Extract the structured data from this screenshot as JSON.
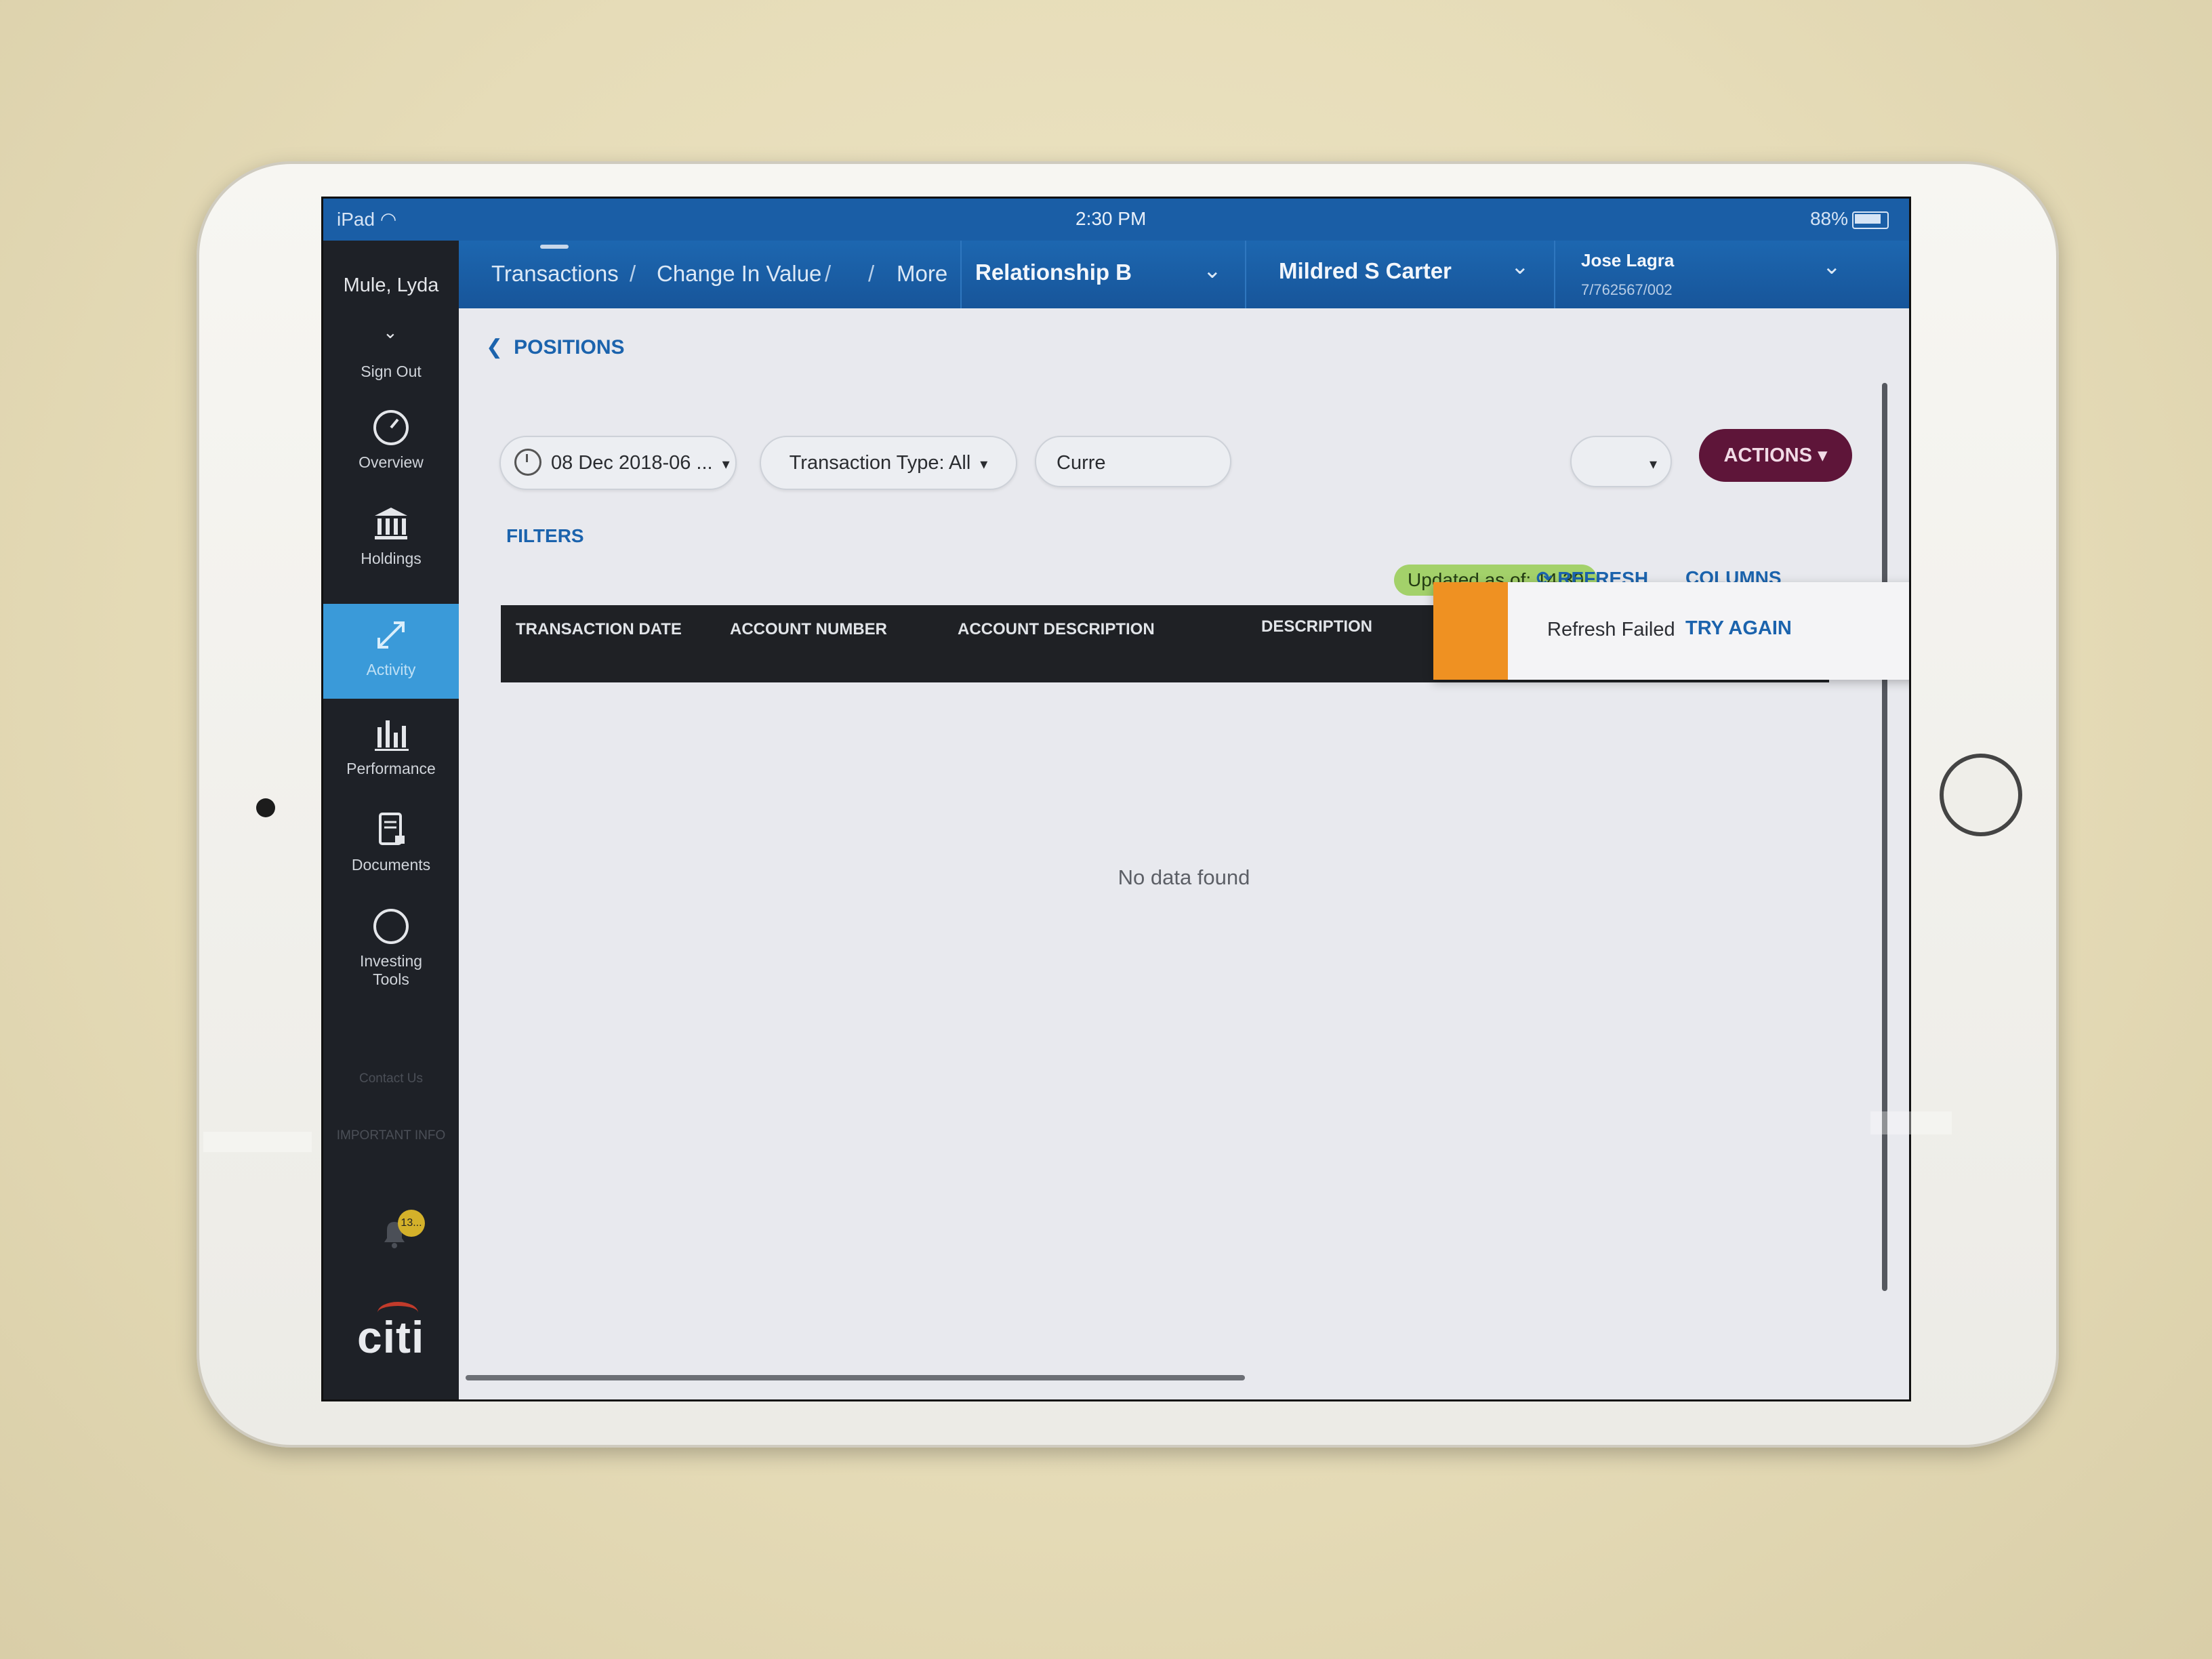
{
  "statusbar": {
    "device": "iPad",
    "time": "2:30 PM",
    "battery": "88%"
  },
  "sidebar": {
    "user_name": "Mule, Lyda",
    "sign_out": "Sign Out",
    "items": [
      {
        "label": "Overview",
        "icon": "gauge-icon"
      },
      {
        "label": "Holdings",
        "icon": "bank-icon"
      },
      {
        "label": "Activity",
        "icon": "arrows-icon",
        "active": true
      },
      {
        "label": "Performance",
        "icon": "bar-chart-icon"
      },
      {
        "label": "Documents",
        "icon": "document-lock-icon"
      },
      {
        "label": "Investing Tools",
        "icon": "compass-icon"
      }
    ],
    "contact_us": "Contact Us",
    "important_info": "IMPORTANT INFO",
    "notification_count": "13...",
    "logo_text": "citi"
  },
  "topnav": {
    "crumbs": [
      "Transactions",
      "Change In Value",
      "More"
    ],
    "separator": "/",
    "relationship": "Relationship B",
    "client": "Mildred S Carter",
    "advisor_name": "Jose Lagra",
    "advisor_id": "7/762567/002"
  },
  "page": {
    "back_label": "POSITIONS",
    "date_filter": "08 Dec 2018-06 ...",
    "transaction_type": "Transaction Type: All",
    "currency_partial": "Curre",
    "actions": "ACTIONS",
    "filters": "FILTERS",
    "updated": "Updated as of: 14:30",
    "refresh": "REFRESH",
    "columns": "COLUMNS",
    "table_headers": [
      "TRANSACTION DATE",
      "ACCOUNT NUMBER",
      "ACCOUNT DESCRIPTION",
      "DESCRIPTION"
    ],
    "empty_message": "No data found"
  },
  "toast": {
    "message": "Refresh Failed",
    "action": "TRY AGAIN",
    "close": "×",
    "accent_color": "#ef9122"
  },
  "colors": {
    "brand_blue": "#1a5ea6",
    "link_blue": "#1b63ad",
    "actions_button": "#5e1539",
    "active_nav": "#3a9ad9",
    "updated_badge": "#a3d16a"
  }
}
